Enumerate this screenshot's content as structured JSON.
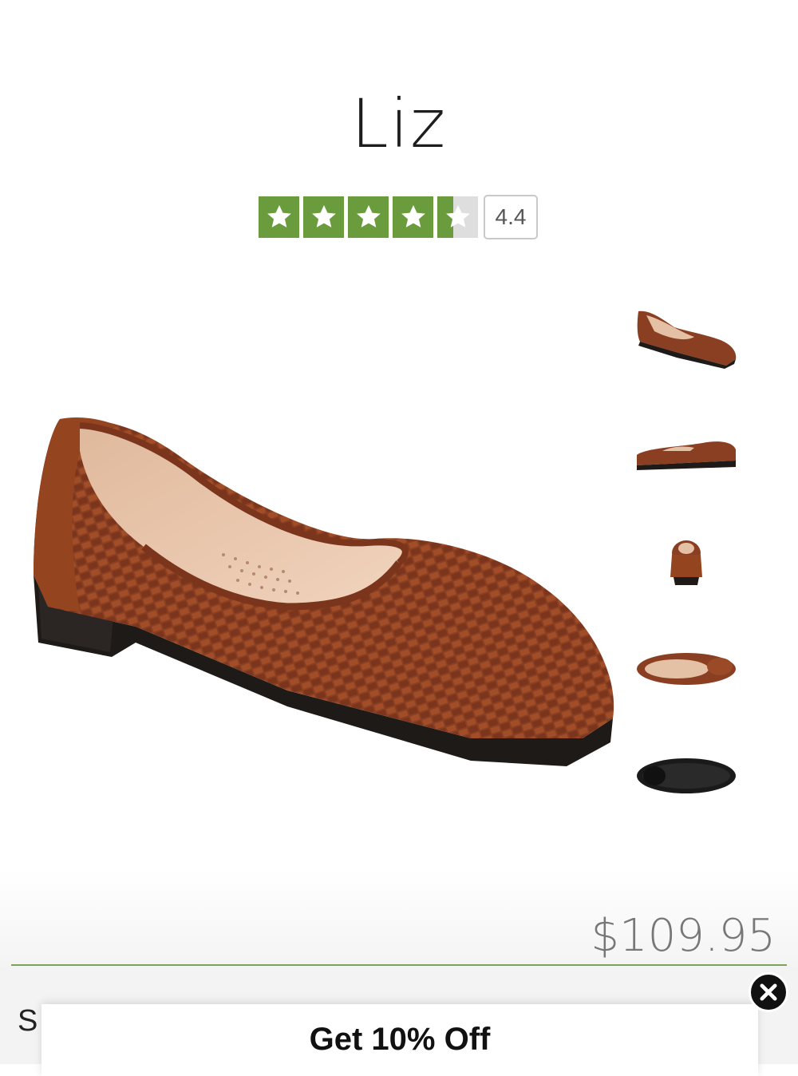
{
  "product": {
    "name": "Liz",
    "rating_value": "4.4",
    "rating_stars": 4.4,
    "price": "$109.95"
  },
  "colors": {
    "star_green": "#6a9b3c",
    "divider_green": "#7ca35a",
    "leather_brown": "#8a3f22"
  },
  "icons": {
    "star": "star-icon",
    "close": "close-icon"
  },
  "gallery": {
    "thumbnail_count": 5
  },
  "promo": {
    "title": "Get 10% Off",
    "peek_text": "S"
  }
}
